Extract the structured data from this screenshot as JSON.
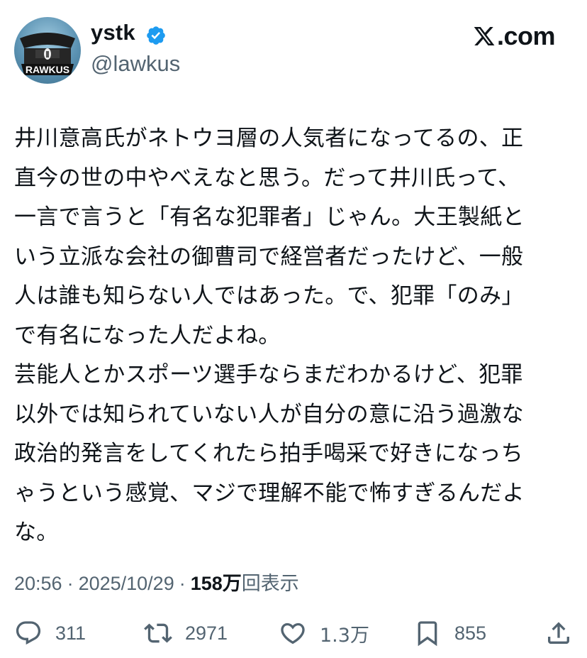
{
  "author": {
    "display_name": "ystk",
    "handle": "@lawkus",
    "avatar_text": "RAWKUS",
    "verified": true
  },
  "brand": {
    "text": ".com"
  },
  "tweet": {
    "text": "井川意高氏がネトウヨ層の人気者になってるの、正\n直今の世の中やべえなと思う。だって井川氏って、\n一言で言うと「有名な犯罪者」じゃん。大王製紙と\nいう立派な会社の御曹司で経営者だったけど、一般\n人は誰も知らない人ではあった。で、犯罪「のみ」\nで有名になった人だよね。\n芸能人とかスポーツ選手ならまだわかるけど、犯罪\n以外では知られていない人が自分の意に沿う過激な\n政治的発言をしてくれたら拍手喝采で好きになっち\nゃうという感覚、マジで理解不能で怖すぎるんだよ\nな。"
  },
  "meta": {
    "time": "20:56",
    "separator": "·",
    "date": "2025/10/29",
    "views_count": "158万",
    "views_label": "回表示"
  },
  "actions": {
    "reply_count": "311",
    "repost_count": "2971",
    "like_count": "1.3万",
    "bookmark_count": "855"
  },
  "colors": {
    "text": "#0f1419",
    "secondary": "#536471",
    "verified": "#1d9bf0"
  },
  "icons": [
    "reply-icon",
    "repost-icon",
    "like-icon",
    "bookmark-icon",
    "share-icon",
    "verified-badge-icon",
    "x-logo-icon"
  ]
}
